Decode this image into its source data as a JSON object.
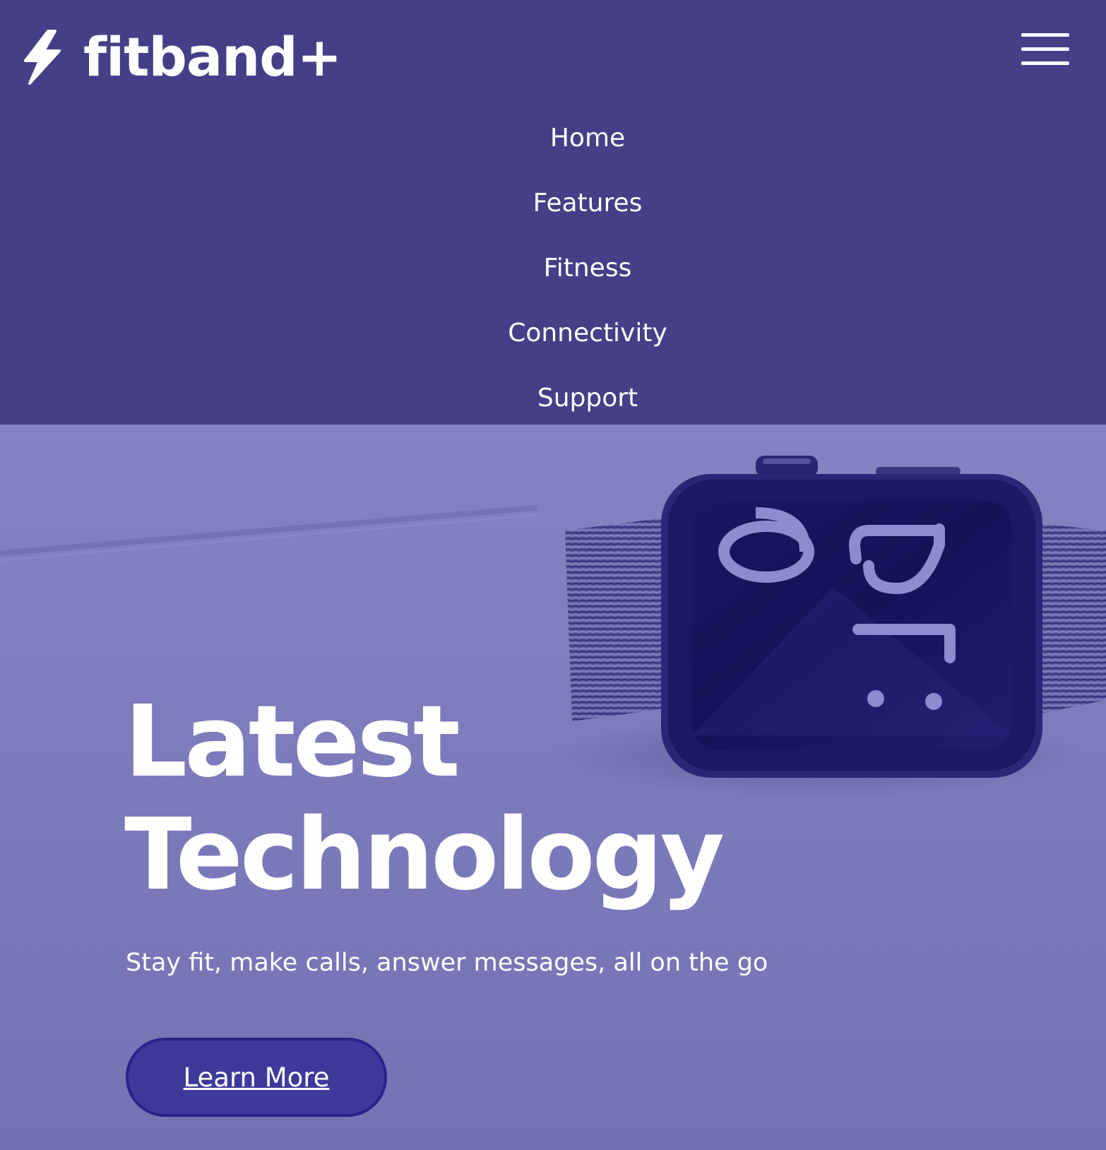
{
  "header": {
    "brand_name": "fitband+",
    "logo_icon": "lightning-bolt-icon",
    "menu_icon": "hamburger-menu-icon"
  },
  "nav": {
    "items": [
      {
        "label": "Home"
      },
      {
        "label": "Features"
      },
      {
        "label": "Fitness"
      },
      {
        "label": "Connectivity"
      },
      {
        "label": "Support"
      }
    ]
  },
  "hero": {
    "title_line1": "Latest",
    "title_line2": "Technology",
    "subtitle": "Stay fit, make calls, answer messages, all on the go",
    "cta_label": "Learn More",
    "image_icon": "smartwatch-photo"
  },
  "colors": {
    "nav_background": "#443f87",
    "hero_background": "#7b79b9",
    "button_background": "#3e3a9c",
    "button_border": "#28238a",
    "text": "#ffffff"
  }
}
